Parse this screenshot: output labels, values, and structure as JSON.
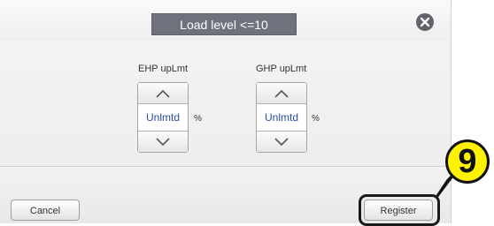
{
  "dialog": {
    "title": "Load level <=10",
    "close_icon": "close-icon"
  },
  "ehp": {
    "label": "EHP upLmt",
    "value": "Unlmtd",
    "unit": "%",
    "up_icon": "chevron-up-icon",
    "down_icon": "chevron-down-icon"
  },
  "ghp": {
    "label": "GHP upLmt",
    "value": "Unlmtd",
    "unit": "%",
    "up_icon": "chevron-up-icon",
    "down_icon": "chevron-down-icon"
  },
  "footer": {
    "cancel_label": "Cancel",
    "register_label": "Register"
  },
  "callout": {
    "number": "9",
    "color": "#fff200"
  }
}
